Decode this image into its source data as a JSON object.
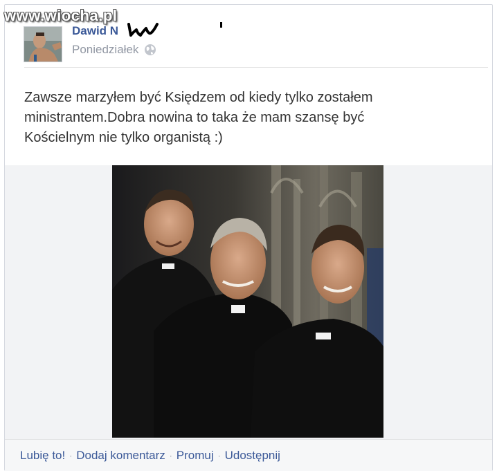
{
  "watermark": "www.wiocha.pl",
  "post": {
    "author": "Dawid N",
    "date": "Poniedziałek",
    "visibility_icon": "globe-icon",
    "text_line1": "Zawsze marzyłem być Księdzem od kiedy tylko zostałem",
    "text_line2": "ministrantem.Dobra nowina to taka że mam szansę być",
    "text_line3": "Kościelnym nie tylko organistą :)",
    "photo_icon": "photo-three-priests"
  },
  "actions": {
    "like": "Lubię to!",
    "comment": "Dodaj komentarz",
    "promote": "Promuj",
    "share": "Udostępnij",
    "separator": "·"
  },
  "colors": {
    "link": "#3b5998",
    "meta": "#9197a3",
    "text": "#333333",
    "action_bar_bg": "#f6f7f8"
  }
}
